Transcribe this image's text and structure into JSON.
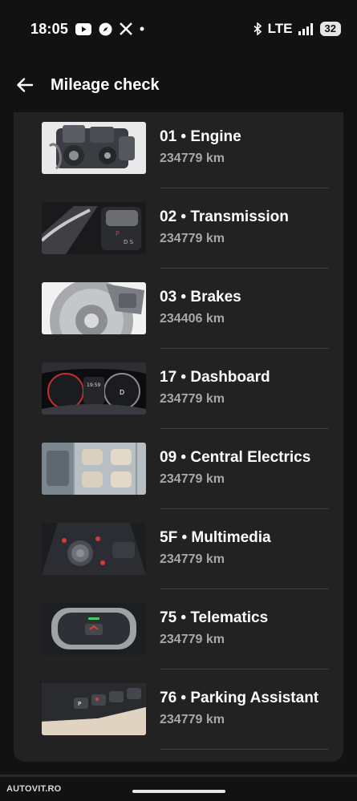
{
  "status_bar": {
    "time": "18:05",
    "network": "LTE",
    "battery": "32",
    "icons": [
      "youtube-icon",
      "compass-icon",
      "x-icon",
      "dot-icon",
      "bluetooth-icon",
      "signal-icon"
    ]
  },
  "header": {
    "title": "Mileage check",
    "back_icon": "arrow-left-icon"
  },
  "modules": [
    {
      "label": "01 • Engine",
      "mileage": "234779 km",
      "image": "engine-photo"
    },
    {
      "label": "02 • Transmission",
      "mileage": "234779 km",
      "image": "gear-selector-photo"
    },
    {
      "label": "03 • Brakes",
      "mileage": "234406 km",
      "image": "brake-disc-photo"
    },
    {
      "label": "17 • Dashboard",
      "mileage": "234779 km",
      "image": "instrument-cluster-photo"
    },
    {
      "label": "09 • Central Electrics",
      "mileage": "234779 km",
      "image": "car-cutaway-photo"
    },
    {
      "label": "5F • Multimedia",
      "mileage": "234779 km",
      "image": "mmi-controller-photo"
    },
    {
      "label": "75 • Telematics",
      "mileage": "234779 km",
      "image": "sos-button-photo"
    },
    {
      "label": "76 • Parking Assistant",
      "mileage": "234779 km",
      "image": "parking-buttons-photo"
    }
  ],
  "footer": {
    "brand": "AUTOVIT.RO"
  },
  "colors": {
    "background": "#121212",
    "card": "#222222",
    "subtext": "#a8a8a8"
  }
}
